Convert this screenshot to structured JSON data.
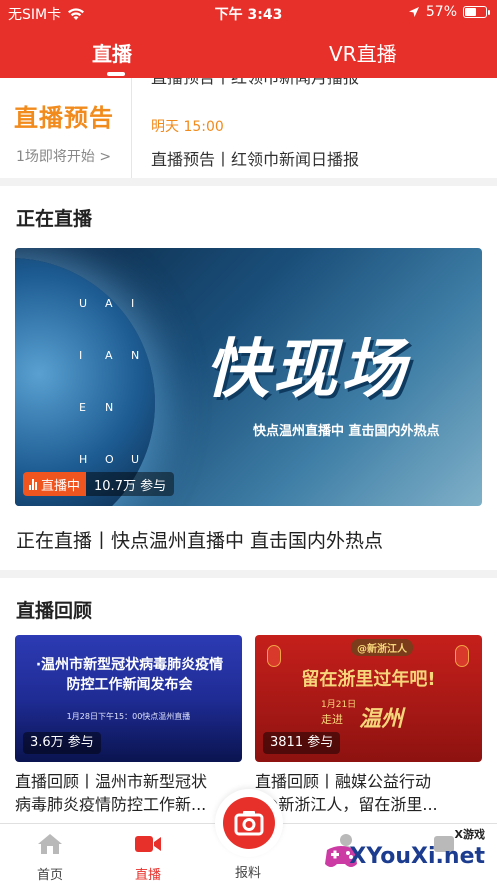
{
  "status_bar": {
    "carrier": "无SIM卡",
    "time": "下午 3:43",
    "battery": "57%",
    "battery_level": 0.57
  },
  "top_tabs": [
    {
      "label": "直播",
      "active": true
    },
    {
      "label": "VR直播",
      "active": false
    }
  ],
  "preview": {
    "logo_text": "直播预告",
    "count_text": "1场即将开始 >",
    "top_item": "直播预告丨红领巾新闻月播报",
    "time": "明天 15:00",
    "bottom_item": "直播预告丨红领巾新闻日播报"
  },
  "now_live": {
    "section_title": "正在直播",
    "banner": {
      "logo_text": "快现场",
      "subtitle": "快点温州直播中  直击国内外热点",
      "globe_letters": [
        "U",
        "A",
        "I",
        "I",
        "A",
        "N",
        "E",
        "N",
        "H",
        "O",
        "U"
      ]
    },
    "badge_label": "直播中",
    "views": "10.7万 参与",
    "caption": "正在直播丨快点温州直播中 直击国内外热点"
  },
  "replay": {
    "section_title": "直播回顾",
    "cards": [
      {
        "thumb_title_line1": "·温州市新型冠状病毒肺炎疫情",
        "thumb_title_line2": "防控工作新闻发布会",
        "thumb_subtitle": "1月28日下午15：00快点温州直播",
        "views": "3.6万 参与",
        "caption_line1": "直播回顾丨温州市新型冠状",
        "caption_line2": "病毒肺炎疫情防控工作新..."
      },
      {
        "thumb_tag": "@新浙江人",
        "thumb_title": "留在浙里过年吧!",
        "thumb_date": "1月21日",
        "thumb_go": "走进",
        "thumb_city": "温州",
        "views": "3811 参与",
        "caption_line1": "直播回顾丨融媒公益行动",
        "caption_line2": "\"@新浙江人，留在浙里..."
      }
    ]
  },
  "bottom_nav": {
    "items": [
      {
        "label": "首页",
        "icon": "home-icon"
      },
      {
        "label": "直播",
        "icon": "video-icon",
        "active": true
      },
      {
        "label": "报料",
        "icon": "camera-icon"
      },
      {
        "label": "",
        "icon": "user-icon"
      },
      {
        "label": "",
        "icon": "service-icon"
      }
    ]
  },
  "watermark": {
    "top_text": "X游戏",
    "main_text": "XYouXi.net"
  },
  "colors": {
    "brand_red": "#e8302a",
    "accent_orange": "#f28b1d",
    "live_badge": "#f0541f"
  }
}
